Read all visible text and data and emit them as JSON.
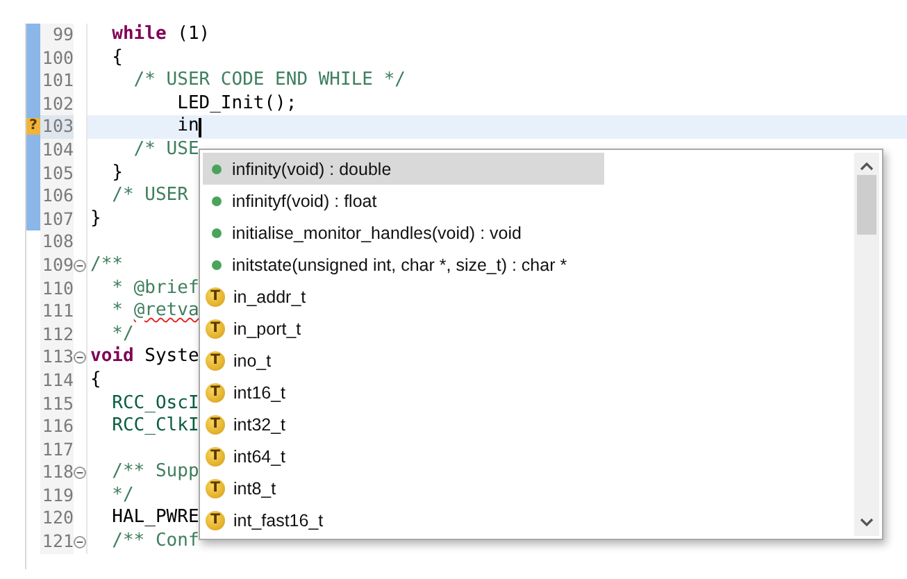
{
  "editor": {
    "lines": [
      {
        "number": "99",
        "changed": true,
        "foldable": false,
        "current": false,
        "code": [
          {
            "text": "  while",
            "kind": "keyword"
          },
          {
            "text": " (1)",
            "kind": "plain"
          }
        ]
      },
      {
        "number": "100",
        "changed": true,
        "foldable": false,
        "current": false,
        "code": [
          {
            "text": "  {",
            "kind": "plain"
          }
        ]
      },
      {
        "number": "101",
        "changed": true,
        "foldable": false,
        "current": false,
        "code": [
          {
            "text": "    /* USER CODE END WHILE */",
            "kind": "comment"
          }
        ]
      },
      {
        "number": "102",
        "changed": true,
        "foldable": false,
        "current": false,
        "code": [
          {
            "text": "        LED_Init();",
            "kind": "plain"
          }
        ]
      },
      {
        "number": "103",
        "changed": true,
        "foldable": false,
        "current": true,
        "marker": "?",
        "code": [
          {
            "text": "        in",
            "kind": "plain"
          }
        ]
      },
      {
        "number": "104",
        "changed": true,
        "foldable": false,
        "current": false,
        "code": [
          {
            "text": "    /* USE",
            "kind": "comment"
          }
        ]
      },
      {
        "number": "105",
        "changed": true,
        "foldable": false,
        "current": false,
        "code": [
          {
            "text": "  }",
            "kind": "plain"
          }
        ]
      },
      {
        "number": "106",
        "changed": true,
        "foldable": false,
        "current": false,
        "code": [
          {
            "text": "  /* USER",
            "kind": "comment"
          }
        ]
      },
      {
        "number": "107",
        "changed": true,
        "foldable": false,
        "current": false,
        "code": [
          {
            "text": "}",
            "kind": "plain"
          }
        ]
      },
      {
        "number": "108",
        "changed": false,
        "foldable": false,
        "current": false
      },
      {
        "number": "109",
        "changed": false,
        "foldable": true,
        "current": false,
        "code": [
          {
            "text": "/**",
            "kind": "comment"
          }
        ]
      },
      {
        "number": "110",
        "changed": false,
        "foldable": false,
        "current": false,
        "code": [
          {
            "text": "  * @brief",
            "kind": "comment"
          }
        ]
      },
      {
        "number": "111",
        "changed": false,
        "foldable": false,
        "current": false,
        "code": [
          {
            "text": "  * ",
            "kind": "comment"
          },
          {
            "text": "@retva",
            "kind": "error"
          }
        ]
      },
      {
        "number": "112",
        "changed": false,
        "foldable": false,
        "current": false,
        "code": [
          {
            "text": "  */",
            "kind": "comment"
          }
        ]
      },
      {
        "number": "113",
        "changed": false,
        "foldable": true,
        "current": false,
        "code": [
          {
            "text": "void",
            "kind": "keyword"
          },
          {
            "text": " Syste",
            "kind": "plain"
          }
        ]
      },
      {
        "number": "114",
        "changed": false,
        "foldable": false,
        "current": false,
        "code": [
          {
            "text": "{",
            "kind": "plain"
          }
        ]
      },
      {
        "number": "115",
        "changed": false,
        "foldable": false,
        "current": false,
        "code": [
          {
            "text": "  RCC_OscI",
            "kind": "variable"
          }
        ]
      },
      {
        "number": "116",
        "changed": false,
        "foldable": false,
        "current": false,
        "code": [
          {
            "text": "  RCC_ClkI",
            "kind": "variable"
          }
        ]
      },
      {
        "number": "117",
        "changed": false,
        "foldable": false,
        "current": false
      },
      {
        "number": "118",
        "changed": false,
        "foldable": true,
        "current": false,
        "code": [
          {
            "text": "  /** Supp",
            "kind": "comment"
          }
        ]
      },
      {
        "number": "119",
        "changed": false,
        "foldable": false,
        "current": false,
        "code": [
          {
            "text": "  */",
            "kind": "comment"
          }
        ]
      },
      {
        "number": "120",
        "changed": false,
        "foldable": false,
        "current": false,
        "code": [
          {
            "text": "  HAL_PWRE",
            "kind": "plain"
          }
        ]
      },
      {
        "number": "121",
        "changed": false,
        "foldable": true,
        "current": false,
        "code": [
          {
            "text": "  /** Conf",
            "kind": "comment"
          }
        ]
      }
    ]
  },
  "completions": {
    "items": [
      {
        "label": "infinity(void) : double",
        "kind": "function",
        "selected": true
      },
      {
        "label": "infinityf(void) : float",
        "kind": "function",
        "selected": false
      },
      {
        "label": "initialise_monitor_handles(void) : void",
        "kind": "function",
        "selected": false
      },
      {
        "label": "initstate(unsigned int, char *, size_t) : char *",
        "kind": "function",
        "selected": false
      },
      {
        "label": "in_addr_t",
        "kind": "type",
        "badge": "T",
        "selected": false
      },
      {
        "label": "in_port_t",
        "kind": "type",
        "badge": "T",
        "selected": false
      },
      {
        "label": "ino_t",
        "kind": "type",
        "badge": "T",
        "selected": false
      },
      {
        "label": "int16_t",
        "kind": "type",
        "badge": "T",
        "selected": false
      },
      {
        "label": "int32_t",
        "kind": "type",
        "badge": "T",
        "selected": false
      },
      {
        "label": "int64_t",
        "kind": "type",
        "badge": "T",
        "selected": false
      },
      {
        "label": "int8_t",
        "kind": "type",
        "badge": "T",
        "selected": false
      },
      {
        "label": "int_fast16_t",
        "kind": "type",
        "badge": "T",
        "selected": false
      }
    ]
  }
}
